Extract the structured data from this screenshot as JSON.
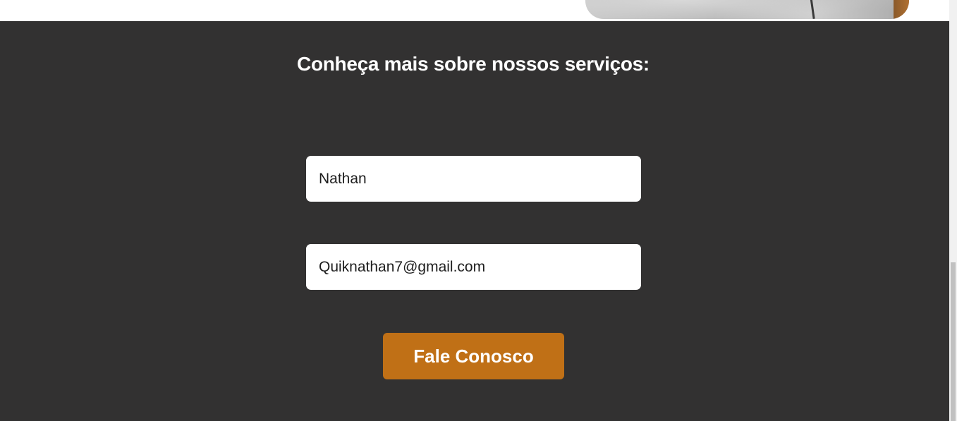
{
  "contact": {
    "title": "Conheça mais sobre nossos serviços:",
    "name_value": "Nathan",
    "email_value": "Quiknathan7@gmail.com",
    "submit_label": "Fale Conosco"
  },
  "colors": {
    "section_background": "#323131",
    "button_background": "#c07016",
    "input_background": "#ffffff",
    "title_text": "#ffffff"
  },
  "icons": {
    "hero": "hero-image"
  }
}
